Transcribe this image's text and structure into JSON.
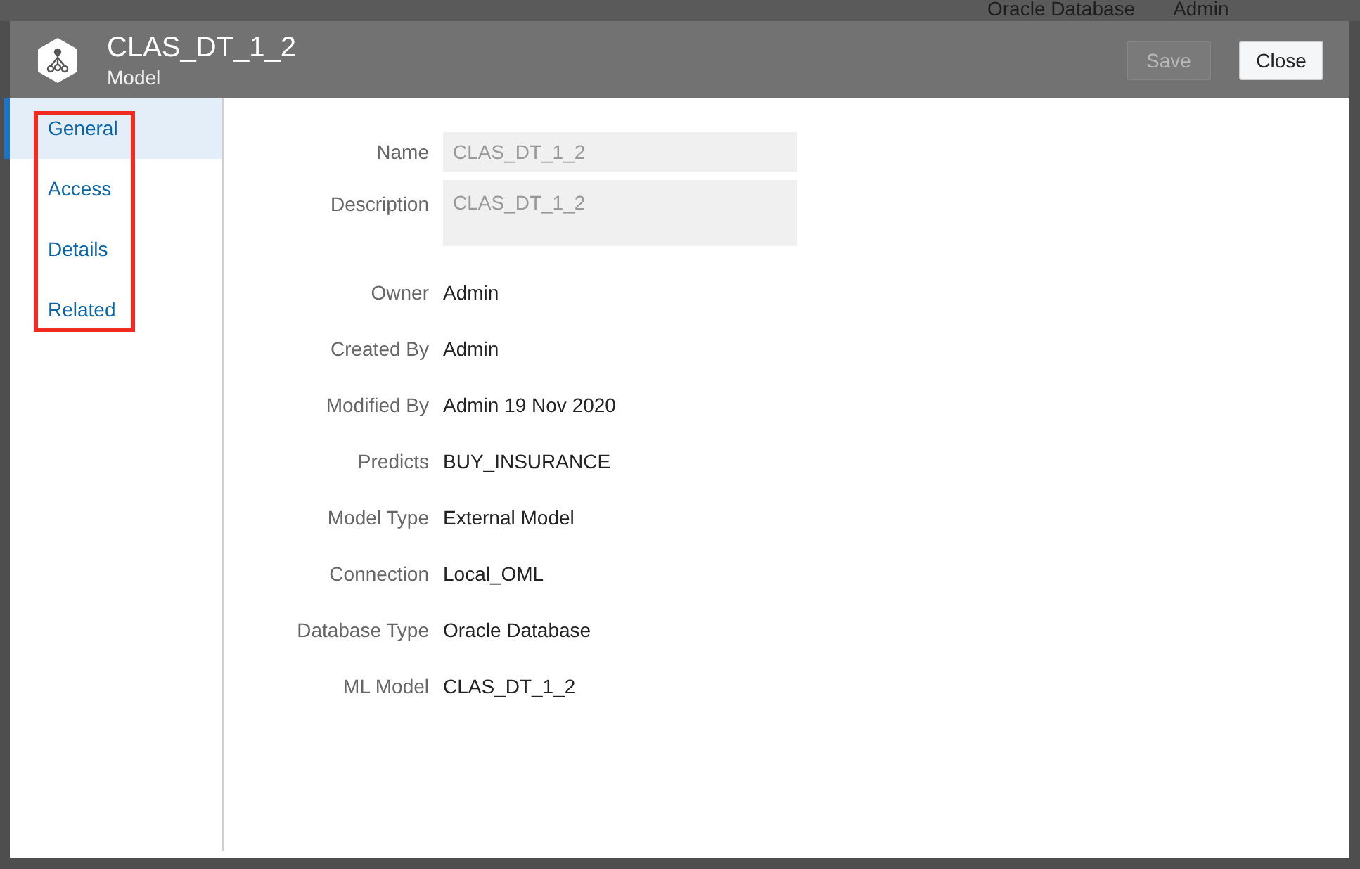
{
  "background": {
    "texts": [
      "Oracle Database",
      "Admin"
    ]
  },
  "dialog": {
    "title": "CLAS_DT_1_2",
    "subtitle": "Model",
    "buttons": [
      {
        "label": "Save",
        "disabled": true
      },
      {
        "label": "Close",
        "disabled": false
      }
    ]
  },
  "tabs": [
    {
      "label": "General",
      "selected": true
    },
    {
      "label": "Access",
      "selected": false
    },
    {
      "label": "Details",
      "selected": false
    },
    {
      "label": "Related",
      "selected": false
    }
  ],
  "fields": [
    {
      "kind": "input",
      "label": "Name",
      "value": "CLAS_DT_1_2"
    },
    {
      "kind": "textarea",
      "label": "Description",
      "value": "CLAS_DT_1_2"
    },
    {
      "kind": "text",
      "label": "Owner",
      "value": "Admin"
    },
    {
      "kind": "text",
      "label": "Created By",
      "value": "Admin"
    },
    {
      "kind": "text",
      "label": "Modified By",
      "value": "Admin 19 Nov 2020"
    },
    {
      "kind": "text",
      "label": "Predicts",
      "value": "BUY_INSURANCE"
    },
    {
      "kind": "text",
      "label": "Model Type",
      "value": "External Model"
    },
    {
      "kind": "text",
      "label": "Connection",
      "value": "Local_OML"
    },
    {
      "kind": "text",
      "label": "Database Type",
      "value": "Oracle Database"
    },
    {
      "kind": "text",
      "label": "ML Model",
      "value": "CLAS_DT_1_2"
    }
  ]
}
